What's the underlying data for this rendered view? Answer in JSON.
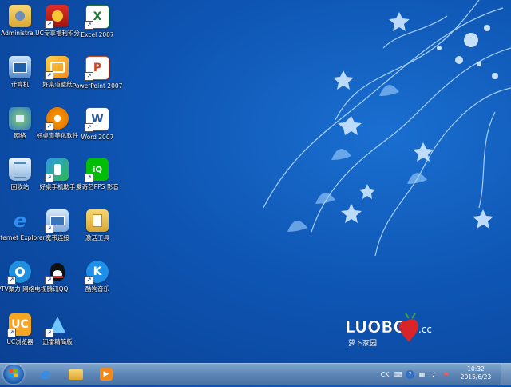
{
  "desktop": {
    "icons": [
      {
        "label": "Administra...",
        "icon": "folder-icon"
      },
      {
        "label": "UC专享福利积分",
        "icon": "uc-rewards-icon"
      },
      {
        "label": "Excel 2007",
        "icon": "excel-icon"
      },
      {
        "label": "计算机",
        "icon": "computer-icon"
      },
      {
        "label": "好桌道壁纸",
        "icon": "wallpaper-app-icon"
      },
      {
        "label": "PowerPoint 2007",
        "icon": "powerpoint-icon"
      },
      {
        "label": "网络",
        "icon": "network-icon"
      },
      {
        "label": "好桌道美化软件",
        "icon": "beautify-app-icon"
      },
      {
        "label": "Word 2007",
        "icon": "word-icon"
      },
      {
        "label": "回收站",
        "icon": "recycle-bin-icon"
      },
      {
        "label": "好桌手机助手",
        "icon": "phone-assistant-icon"
      },
      {
        "label": "爱奇艺PPS 影音",
        "icon": "iqiyi-icon"
      },
      {
        "label": "Internet Explorer",
        "icon": "internet-explorer-icon"
      },
      {
        "label": "宽带连接",
        "icon": "broadband-icon"
      },
      {
        "label": "激活工具",
        "icon": "activation-tool-icon"
      },
      {
        "label": "PPTV聚力 网络电视",
        "icon": "pptv-icon"
      },
      {
        "label": "腾讯QQ",
        "icon": "qq-icon"
      },
      {
        "label": "酷狗音乐",
        "icon": "kugou-icon"
      },
      {
        "label": "UC浏览器",
        "icon": "uc-browser-icon"
      },
      {
        "label": "迅雷精简版",
        "icon": "thunder-icon"
      }
    ]
  },
  "wallpaper": {
    "logo_text": "LUOBO",
    "logo_suffix": ".cc",
    "logo_subtitle": "萝卜家园"
  },
  "taskbar": {
    "pinned": [
      "internet-explorer-icon",
      "folder-icon",
      "media-player-icon"
    ],
    "tray": {
      "language": "CK",
      "icons": [
        "keyboard-icon",
        "help-icon",
        "network-status-icon",
        "volume-icon",
        "action-center-icon"
      ]
    },
    "clock": {
      "time": "10:32",
      "date": "2015/6/23"
    }
  },
  "colors": {
    "desktop_blue": "#0e55b3",
    "taskbar": "#5d86b6",
    "logo_red": "#d9252a"
  }
}
